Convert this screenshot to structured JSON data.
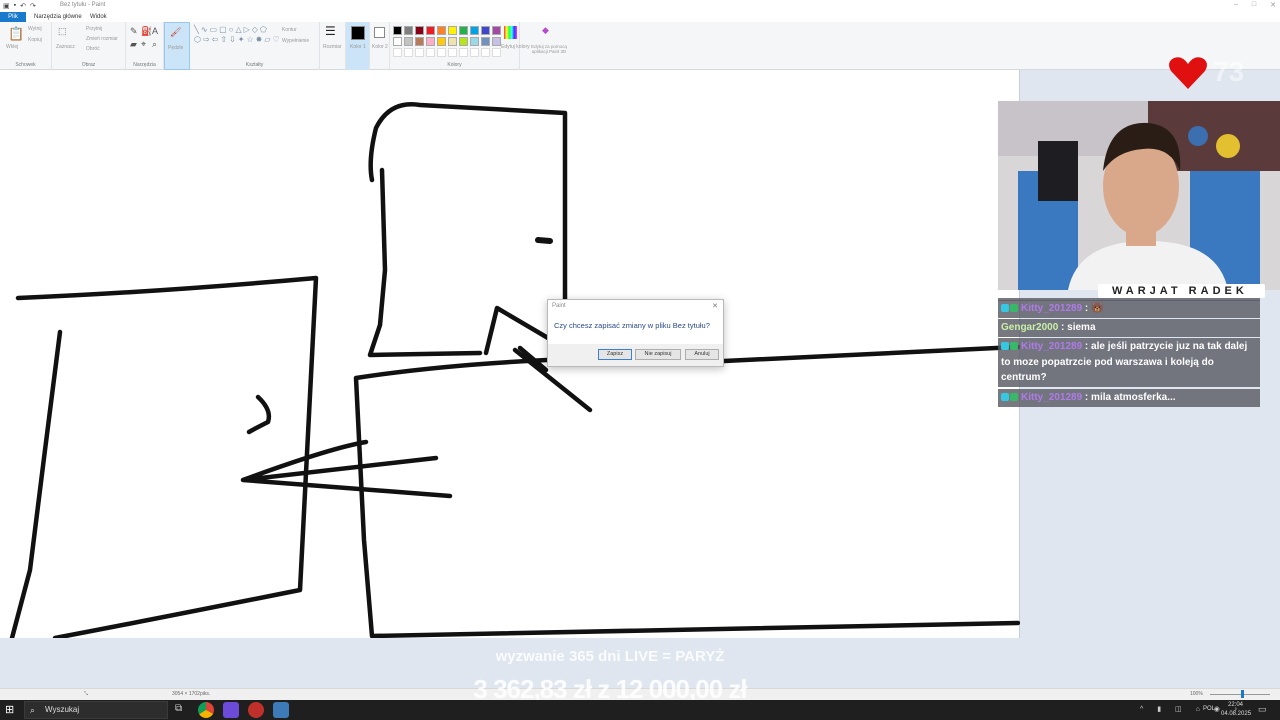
{
  "titlebar": {
    "title": "Bez tytułu - Paint"
  },
  "menu": {
    "file": "Plik",
    "home": "Narzędzia główne",
    "view": "Widok"
  },
  "ribbon": {
    "clipboard": {
      "paste": "Wklej",
      "cut": "Wytnij",
      "copy": "Kopiuj",
      "label": "Schowek"
    },
    "image": {
      "select": "Zaznacz",
      "crop": "Przytnij",
      "resize": "Zmień rozmiar",
      "rotate": "Obróć",
      "label": "Obraz"
    },
    "tools": {
      "label": "Narzędzia"
    },
    "brushes": {
      "label": "Pędzle"
    },
    "shapes": {
      "outline": "Kontur",
      "fill": "Wypełnienie",
      "label": "Kształty"
    },
    "size": {
      "label": "Rozmiar"
    },
    "color1": "Kolor 1",
    "color2": "Kolor 2",
    "colors_label": "Kolory",
    "edit_colors": "Edytuj kolory",
    "paint3d": "Edytuj za pomocą aplikacji Paint 3D",
    "palette": [
      "#000000",
      "#7f7f7f",
      "#880015",
      "#ed1c24",
      "#ff7f27",
      "#fff200",
      "#22b14c",
      "#00a2e8",
      "#3f48cc",
      "#a349a4",
      "#ffffff",
      "#c3c3c3",
      "#b97a57",
      "#ffaec9",
      "#ffc90e",
      "#efe4b0",
      "#b5e61d",
      "#99d9ea",
      "#7092be",
      "#c8bfe7"
    ]
  },
  "dialog": {
    "title": "Paint",
    "message": "Czy chcesz zapisać zmiany w pliku Bez tytułu?",
    "save": "Zapisz",
    "dont_save": "Nie zapisuj",
    "cancel": "Anuluj"
  },
  "statusbar": {
    "dimensions": "3054 × 1702piks.",
    "zoom": "100%"
  },
  "taskbar": {
    "search_placeholder": "Wyszukaj",
    "lang": "POL",
    "time": "22:04",
    "date": "04.08.2025"
  },
  "stream": {
    "heart_count": "73",
    "streamer_name": "WARJAT RADEK",
    "challenge": "wyzwanie 365 dni LIVE = PARYŻ",
    "goal": "3 362,83 zł  z  12 000,00 zł",
    "chat": [
      {
        "user": "Kitty_201289",
        "message": "",
        "partial": true
      },
      {
        "user": "Kitty_201289",
        "message": "",
        "emote": true
      },
      {
        "user": "Gengar2000",
        "message": "siema"
      },
      {
        "user": "Kitty_201289",
        "message": "ale jeśli patrzycie juz na tak dalej to moze popatrzcie pod warszawa i koleją do centrum?"
      },
      {
        "user": "Kitty_201289",
        "message": "mila atmosferka..."
      }
    ]
  }
}
